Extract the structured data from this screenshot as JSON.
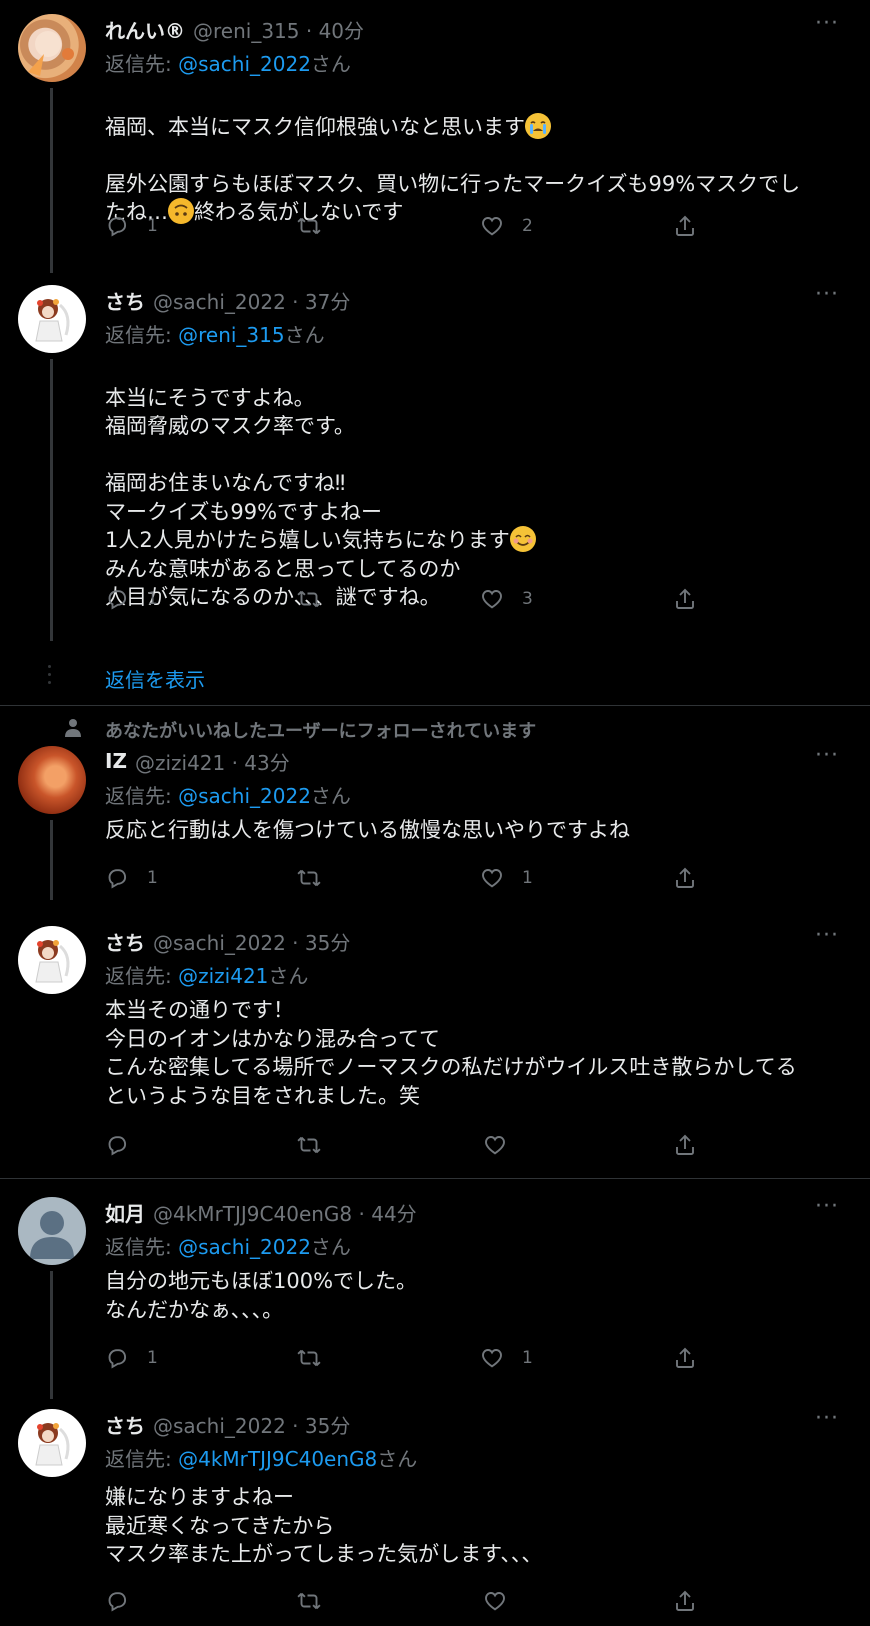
{
  "colors": {
    "background": "#000000",
    "text": "#e7e9ea",
    "muted": "#71767b",
    "accent": "#1d9bf0",
    "line": "#333639"
  },
  "reply_prefix": "返信先: ",
  "reply_suffix": "さん",
  "tweets": [
    {
      "name": "れんい®",
      "handle": "@reni_315 · 40分",
      "reply_to": "@sachi_2022",
      "text_a": "福岡、本当にマスク信仰根強いなと思います",
      "text_b": "屋外公園すらもほぼマスク、買い物に行ったマークイズも99%マスクでし",
      "text_c": "たね…",
      "text_d": "終わる気がしないです",
      "replies": "1",
      "retweets": "",
      "likes": "2"
    },
    {
      "name": "さち",
      "handle": "@sachi_2022 · 37分",
      "reply_to": "@reni_315",
      "text_a": "本当にそうですよね。\n福岡脅威のマスク率です。\n\n福岡お住まいなんですね‼︎\nマークイズも99%ですよねー\n1人2人見かけたら嬉しい気持ちになります",
      "text_b": "みんな意味があると思ってしてるのか\n人目が気になるのか、、、謎ですね。",
      "replies": "1",
      "retweets": "",
      "likes": "3"
    },
    {
      "name": "IZ",
      "handle": "@zizi421 · 43分",
      "reply_to": "@sachi_2022",
      "text": "反応と行動は人を傷つけている傲慢な思いやりですよね",
      "replies": "1",
      "retweets": "",
      "likes": "1"
    },
    {
      "name": "さち",
      "handle": "@sachi_2022 · 35分",
      "reply_to": "@zizi421",
      "text": "本当その通りです！\n今日のイオンはかなり混み合ってて\nこんな密集してる場所でノーマスクの私だけがウイルス吐き散らかしてる\nというような目をされました。笑",
      "replies": "",
      "retweets": "",
      "likes": ""
    },
    {
      "name": "如月",
      "handle": "@4kMrTJJ9C40enG8 · 44分",
      "reply_to": "@sachi_2022",
      "text": "自分の地元もほぼ100%でした。\nなんだかなぁ、、、。",
      "replies": "1",
      "retweets": "",
      "likes": "1"
    },
    {
      "name": "さち",
      "handle": "@sachi_2022 · 35分",
      "reply_to": "@4kMrTJJ9C40enG8",
      "text": "嫌になりますよねー\n最近寒くなってきたから\nマスク率また上がってしまった気がします、、、",
      "replies": "",
      "retweets": "",
      "likes": ""
    }
  ],
  "show_replies": "返信を表示",
  "social_context": "あなたがいいねしたユーザーにフォローされています",
  "more_label": "···",
  "icons": [
    "reply-icon",
    "retweet-icon",
    "like-icon",
    "share-icon",
    "more-icon",
    "person-icon"
  ]
}
